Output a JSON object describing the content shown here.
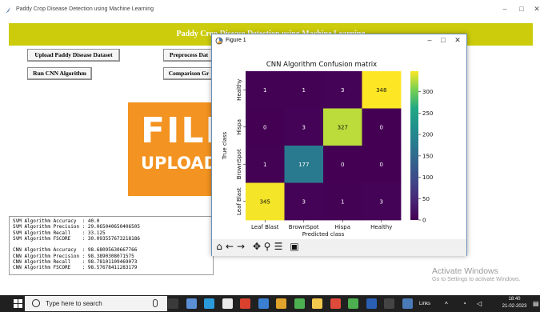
{
  "window": {
    "title": "Paddy Crop Disease Detection using Machine Learning",
    "minimize": "–",
    "maximize": "□",
    "close": "✕"
  },
  "app": {
    "header_title": "Paddy Crop Disease Detection using Machine Learning",
    "buttons": {
      "upload": "Upload Paddy Disease Dataset",
      "preprocess": "Preprocess Dat",
      "run_cnn": "Run CNN Algorithm",
      "comparison": "Comparison Gr"
    },
    "logo": {
      "main": "FILE",
      "sub": "UPLOADS"
    },
    "output_lines": [
      "SVM Algorithm Accuracy  : 40.0",
      "SVM Algorithm Precision : 29.065040650406505",
      "SVM Algorithm Recall    : 33.125",
      "SVM Algorithm FSCORE    : 30.093557673218186",
      "",
      "CNN Algorithm Accuracy  : 98.68095630667766",
      "CNN Algorithm Precision : 98.3890308071575",
      "CNN Algorithm Recall    : 98.78101109469073",
      "CNN Algorithm FSCORE    : 98.57678411283179"
    ]
  },
  "figure": {
    "title": "Figure 1",
    "minimize": "–",
    "maximize": "□",
    "close": "✕",
    "toolbar_icons": [
      "home-icon",
      "back-arrow-icon",
      "forward-arrow-icon",
      "pan-icon",
      "zoom-icon",
      "configure-icon",
      "save-icon"
    ]
  },
  "chart_data": {
    "type": "heatmap",
    "title": "CNN Algorithm Confusion matrix",
    "xlabel": "Predicted class",
    "ylabel": "True class",
    "x_categories": [
      "Leaf Blast",
      "BrownSpot",
      "Hispa",
      "Healthy"
    ],
    "y_categories": [
      "Healthy",
      "Hispa",
      "BrownSpot",
      "Leaf Blast"
    ],
    "values": [
      [
        1,
        1,
        3,
        348
      ],
      [
        0,
        3,
        327,
        0
      ],
      [
        1,
        177,
        0,
        0
      ],
      [
        345,
        3,
        1,
        3
      ]
    ],
    "colorbar": {
      "min": 0,
      "max": 348,
      "ticks": [
        0,
        50,
        100,
        150,
        200,
        250,
        300
      ]
    },
    "colormap": "viridis"
  },
  "desktop": {
    "watermark_title": "Activate Windows",
    "watermark_sub": "Go to Settings to activate Windows."
  },
  "taskbar": {
    "search_placeholder": "Type here to search",
    "links_label": "Links",
    "time": "18:40",
    "date": "21-02-2023",
    "apps": [
      {
        "name": "task-view-icon",
        "color": "#3a3a3a"
      },
      {
        "name": "pen-app-icon",
        "color": "#5b8fd6"
      },
      {
        "name": "edge-icon",
        "color": "#2b9ad8"
      },
      {
        "name": "store-icon",
        "color": "#e8e8e8"
      },
      {
        "name": "chrome-red-icon",
        "color": "#d9412e"
      },
      {
        "name": "media-icon",
        "color": "#3a7fd0"
      },
      {
        "name": "chrome-icon",
        "color": "#e0a32b"
      },
      {
        "name": "chrome-alt-icon",
        "color": "#4caf50"
      },
      {
        "name": "explorer-icon",
        "color": "#f2c94c"
      },
      {
        "name": "paint-icon",
        "color": "#e04a3a"
      },
      {
        "name": "gallery-icon",
        "color": "#4caf50"
      },
      {
        "name": "word-icon",
        "color": "#2b5fb3"
      },
      {
        "name": "terminal-icon",
        "color": "#444444"
      },
      {
        "name": "python-icon",
        "color": "#4a7ab8"
      }
    ]
  }
}
